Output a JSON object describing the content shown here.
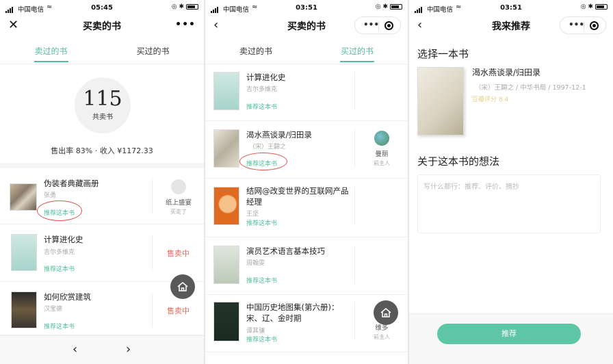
{
  "screens": [
    {
      "status": {
        "carrier": "中国电信",
        "time": "05:45"
      },
      "nav": {
        "title": "买卖的书",
        "close_icon": "close-icon",
        "more_icon": "more-dots-icon"
      },
      "tabs": [
        "卖过的书",
        "买过的书"
      ],
      "active_tab": 0,
      "summary": {
        "count": "115",
        "count_label": "共卖书",
        "rate_label": "售出率",
        "rate": "83%",
        "income_label": "收入",
        "income": "¥1172.33"
      },
      "books": [
        {
          "title": "伪装者典藏画册",
          "author": "张勇",
          "recommend": "推荐这本书",
          "side_name": "纸上盛宴",
          "side_sub": "买走了"
        },
        {
          "title": "计算进化史",
          "author": "吉尔多维克",
          "recommend": "推荐这本书",
          "status": "售卖中"
        },
        {
          "title": "如何欣赏建筑",
          "author": "汉宝德",
          "recommend": "推荐这本书",
          "status": "售卖中"
        }
      ]
    },
    {
      "status": {
        "carrier": "中国电信",
        "time": "03:51"
      },
      "nav": {
        "title": "买卖的书"
      },
      "tabs": [
        "卖过的书",
        "买过的书"
      ],
      "active_tab": 1,
      "books": [
        {
          "title": "计算进化史",
          "author": "吉尔多维克",
          "recommend": "推荐这本书"
        },
        {
          "title": "渴水燕谈录/归田录",
          "author": "（宋）王闢之",
          "recommend": "推荐这本书",
          "side_name": "曼丽",
          "side_sub": "前主人"
        },
        {
          "title": "结网@改变世界的互联网产品经理",
          "author": "王坚",
          "recommend": "推荐这本书"
        },
        {
          "title": "演员艺术语言基本技巧",
          "author": "周翰雯",
          "recommend": "推荐这本书"
        },
        {
          "title": "中国历史地图集(第六册)：宋、辽、金时期",
          "author": "谭其骧",
          "recommend": "推荐这本书",
          "side_name": "维多",
          "side_sub": "前主人"
        }
      ]
    },
    {
      "status": {
        "carrier": "中国电信",
        "time": "03:51"
      },
      "nav": {
        "title": "我来推荐"
      },
      "select_title": "选择一本书",
      "book": {
        "title": "渴水燕谈录/归田录",
        "meta": "（宋）王闢之 / 中华书局 / 1997-12-1",
        "rating": "豆瓣评分 8.4"
      },
      "thoughts_title": "关于这本书的想法",
      "textarea_placeholder": "写什么都行：推荐、评价、摘抄",
      "submit": "推荐"
    }
  ]
}
